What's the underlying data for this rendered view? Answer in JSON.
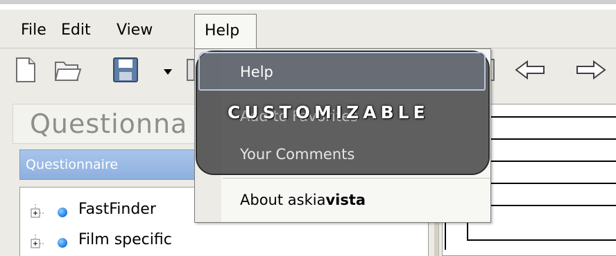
{
  "menubar": {
    "items": [
      "File",
      "Edit",
      "View",
      "Help"
    ]
  },
  "toolbar": {
    "icons": [
      "new-file-icon",
      "open-folder-icon",
      "save-icon",
      "dropdown-arrow-icon",
      "back-arrow-icon",
      "forward-arrow-icon"
    ]
  },
  "left_panel": {
    "title": "Questionna",
    "tab_label": "Questionnaire",
    "tree": [
      {
        "label": "FastFinder"
      },
      {
        "label": "Film specific"
      }
    ]
  },
  "help_menu": {
    "items": [
      {
        "label": "Help"
      },
      {
        "label": "Add to Favorites"
      },
      {
        "label": "Your Comments"
      },
      {
        "label_prefix": "About askia",
        "label_bold": "vista"
      }
    ]
  },
  "overlay": {
    "title": "CUSTOMIZABLE"
  },
  "colors": {
    "accent_tab": "#8eb0e0",
    "node_dot": "#1f78e0",
    "overlay_bg": "#464646"
  }
}
